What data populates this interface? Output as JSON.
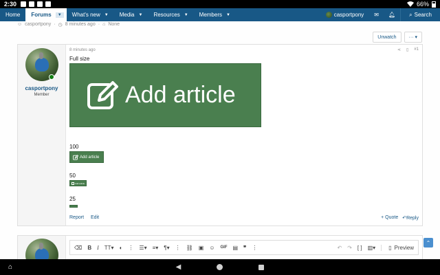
{
  "status": {
    "time": "2:30",
    "battery": "66%"
  },
  "nav": {
    "items": [
      "Home",
      "Forums",
      "What's new",
      "Media",
      "Resources",
      "Members"
    ],
    "user": "casportpony",
    "search": "Search"
  },
  "meta": {
    "author": "casportpony",
    "time": "8 minutes ago",
    "tags": "None"
  },
  "watch": {
    "unwatch": "Unwatch",
    "more": "···"
  },
  "post": {
    "time": "8 minutes ago",
    "number": "#1",
    "user": {
      "name": "casportpony",
      "title": "Member"
    },
    "full_label": "Full size",
    "button_text": "Add article",
    "sizes": [
      "100",
      "50",
      "25"
    ],
    "footer": {
      "report": "Report",
      "edit": "Edit",
      "quote": "+ Quote",
      "reply": "Reply"
    }
  },
  "editor": {
    "preview": "Preview"
  }
}
